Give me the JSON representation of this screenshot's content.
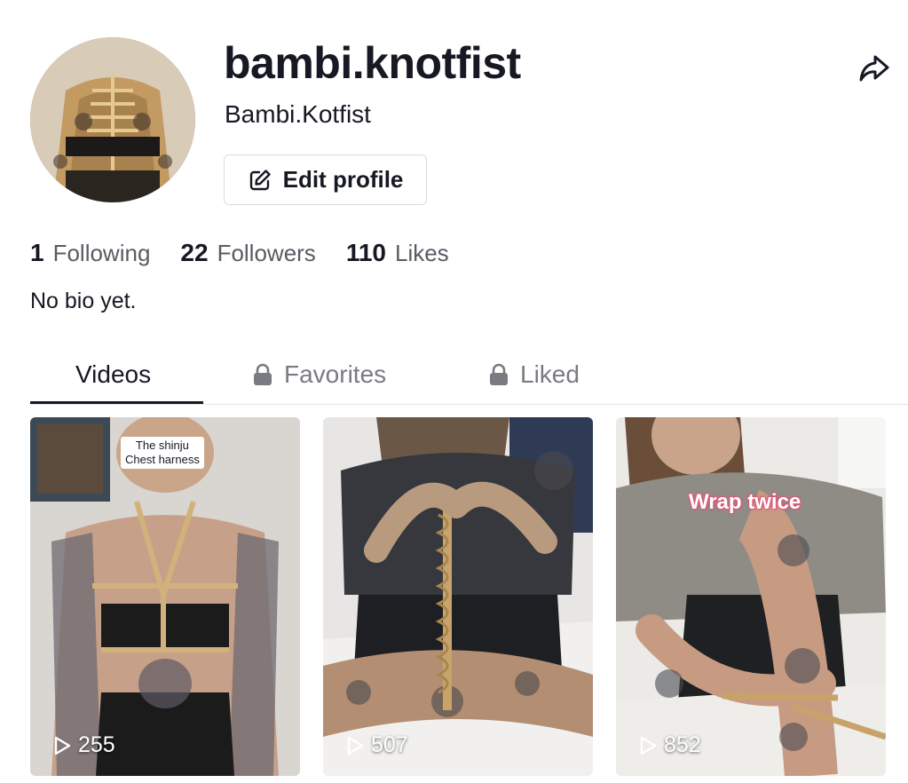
{
  "profile": {
    "username": "bambi.knotfist",
    "nickname": "Bambi.Kotfist",
    "edit_label": "Edit profile",
    "bio": "No bio yet."
  },
  "stats": [
    {
      "value": "1",
      "label": "Following"
    },
    {
      "value": "22",
      "label": "Followers"
    },
    {
      "value": "110",
      "label": "Likes"
    }
  ],
  "tabs": [
    {
      "label": "Videos",
      "active": true,
      "locked": false
    },
    {
      "label": "Favorites",
      "active": false,
      "locked": true
    },
    {
      "label": "Liked",
      "active": false,
      "locked": true
    }
  ],
  "videos": [
    {
      "views": "255",
      "caption_line1": "The shinju",
      "caption_line2": "Chest harness"
    },
    {
      "views": "507"
    },
    {
      "views": "852",
      "overlay_text": "Wrap twice"
    }
  ],
  "icons": {
    "edit": "pencil-square-icon",
    "share": "share-arrow-icon",
    "lock": "lock-icon",
    "play": "play-icon"
  },
  "colors": {
    "text_primary": "#161823",
    "text_secondary": "#5a5b63",
    "divider": "#e5e6e8",
    "caption_pink": "#e0577a"
  }
}
